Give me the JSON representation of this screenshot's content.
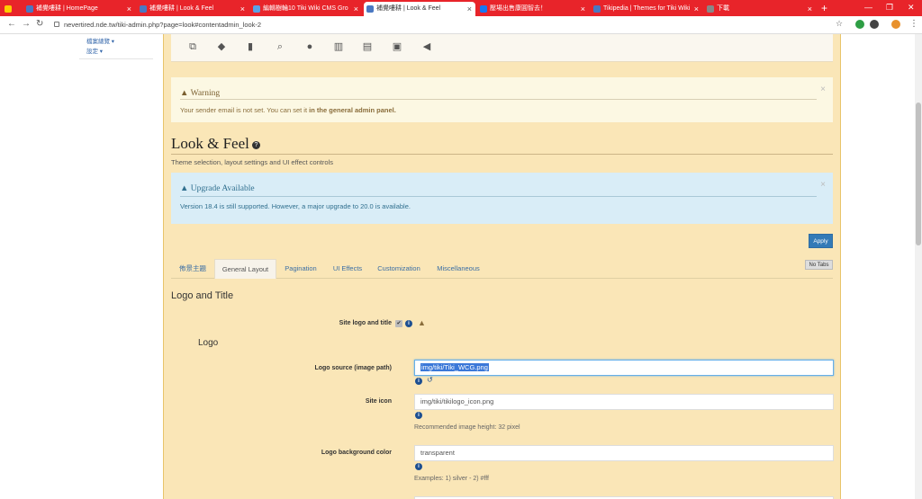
{
  "browser": {
    "tabs": [
      {
        "label": "",
        "favicon_color": "#ffcc00"
      },
      {
        "label": "補覺嘍耕 | HomePage",
        "favicon_color": "#4a78c2"
      },
      {
        "label": "補覺嘍耕 | Look & Feel",
        "favicon_color": "#4a78c2"
      },
      {
        "label": "編輯樹輪10 Tiki Wiki CMS Gro",
        "favicon_color": "#5aa2e6"
      },
      {
        "label": "補覺嘍耕 | Look & Feel",
        "favicon_color": "#4a78c2"
      },
      {
        "label": "壓場出售康圓智去！",
        "favicon_color": "#1877f2"
      },
      {
        "label": "Tikipedia | Themes for Tiki Wiki",
        "favicon_color": "#4a78c2"
      },
      {
        "label": "下載",
        "favicon_color": "#888888"
      }
    ],
    "url": "nevertired.nde.tw/tiki-admin.php?page=look#contentadmin_look-2"
  },
  "leftnav": {
    "item1": "檔案總覽 ▾",
    "item2": "設定 ▾"
  },
  "warning": {
    "title": "Warning",
    "body_prefix": "Your sender email is not set. You can set it ",
    "body_link": "in the general admin panel."
  },
  "page": {
    "title": "Look & Feel",
    "description": "Theme selection, layout settings and UI effect controls"
  },
  "upgrade": {
    "title": "Upgrade Available",
    "body": "Version 18.4 is still supported. However, a major upgrade to 20.0 is available."
  },
  "buttons": {
    "apply": "Apply",
    "no_tabs": "No Tabs"
  },
  "tabs": [
    "佈景主題",
    "General Layout",
    "Pagination",
    "UI Effects",
    "Customization",
    "Miscellaneous"
  ],
  "section": {
    "title": "Logo and Title",
    "site_logo_label": "Site logo and title",
    "logo_heading": "Logo",
    "logo_source_label": "Logo source (image path)",
    "logo_source_value": "img/tiki/Tiki_WCG.png",
    "site_icon_label": "Site icon",
    "site_icon_value": "img/tiki/tikilogo_icon.png",
    "site_icon_hint": "Recommended image height: 32 pixel",
    "bg_color_label": "Logo background color",
    "bg_color_value": "transparent",
    "bg_color_hint": "Examples: 1) silver - 2) #fff"
  }
}
